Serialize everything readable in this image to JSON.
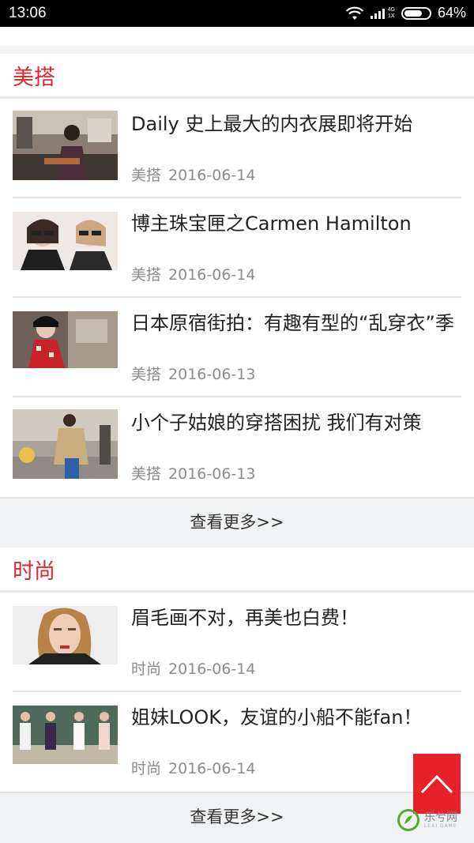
{
  "status": {
    "time": "13:06",
    "network_top": "4G",
    "network_bottom": "1X",
    "battery": "64%"
  },
  "sections": [
    {
      "title": "美搭",
      "more": "查看更多>>",
      "items": [
        {
          "title": "Daily 史上最大的内衣展即将开始",
          "tag": "美搭",
          "date": "2016-06-14"
        },
        {
          "title": "博主珠宝匣之Carmen Hamilton",
          "tag": "美搭",
          "date": "2016-06-14"
        },
        {
          "title": "日本原宿街拍：有趣有型的“乱穿衣”季",
          "tag": "美搭",
          "date": "2016-06-13"
        },
        {
          "title": "小个子姑娘的穿搭困扰 我们有对策",
          "tag": "美搭",
          "date": "2016-06-13"
        }
      ]
    },
    {
      "title": "时尚",
      "more": "查看更多>>",
      "items": [
        {
          "title": "眉毛画不对，再美也白费！",
          "tag": "时尚",
          "date": "2016-06-14"
        },
        {
          "title": "姐妹LOOK，友谊的小船不能fan！",
          "tag": "时尚",
          "date": "2016-06-14"
        }
      ]
    }
  ],
  "watermark": {
    "text": "乐兮网",
    "sub": "LEXI GAME"
  },
  "icons": {
    "wifi": "wifi-icon",
    "signal": "signal-icon",
    "battery": "battery-icon",
    "back_to_top": "chevron-up-icon"
  },
  "colors": {
    "accent": "#e0262c",
    "back_to_top": "#e6212a"
  }
}
